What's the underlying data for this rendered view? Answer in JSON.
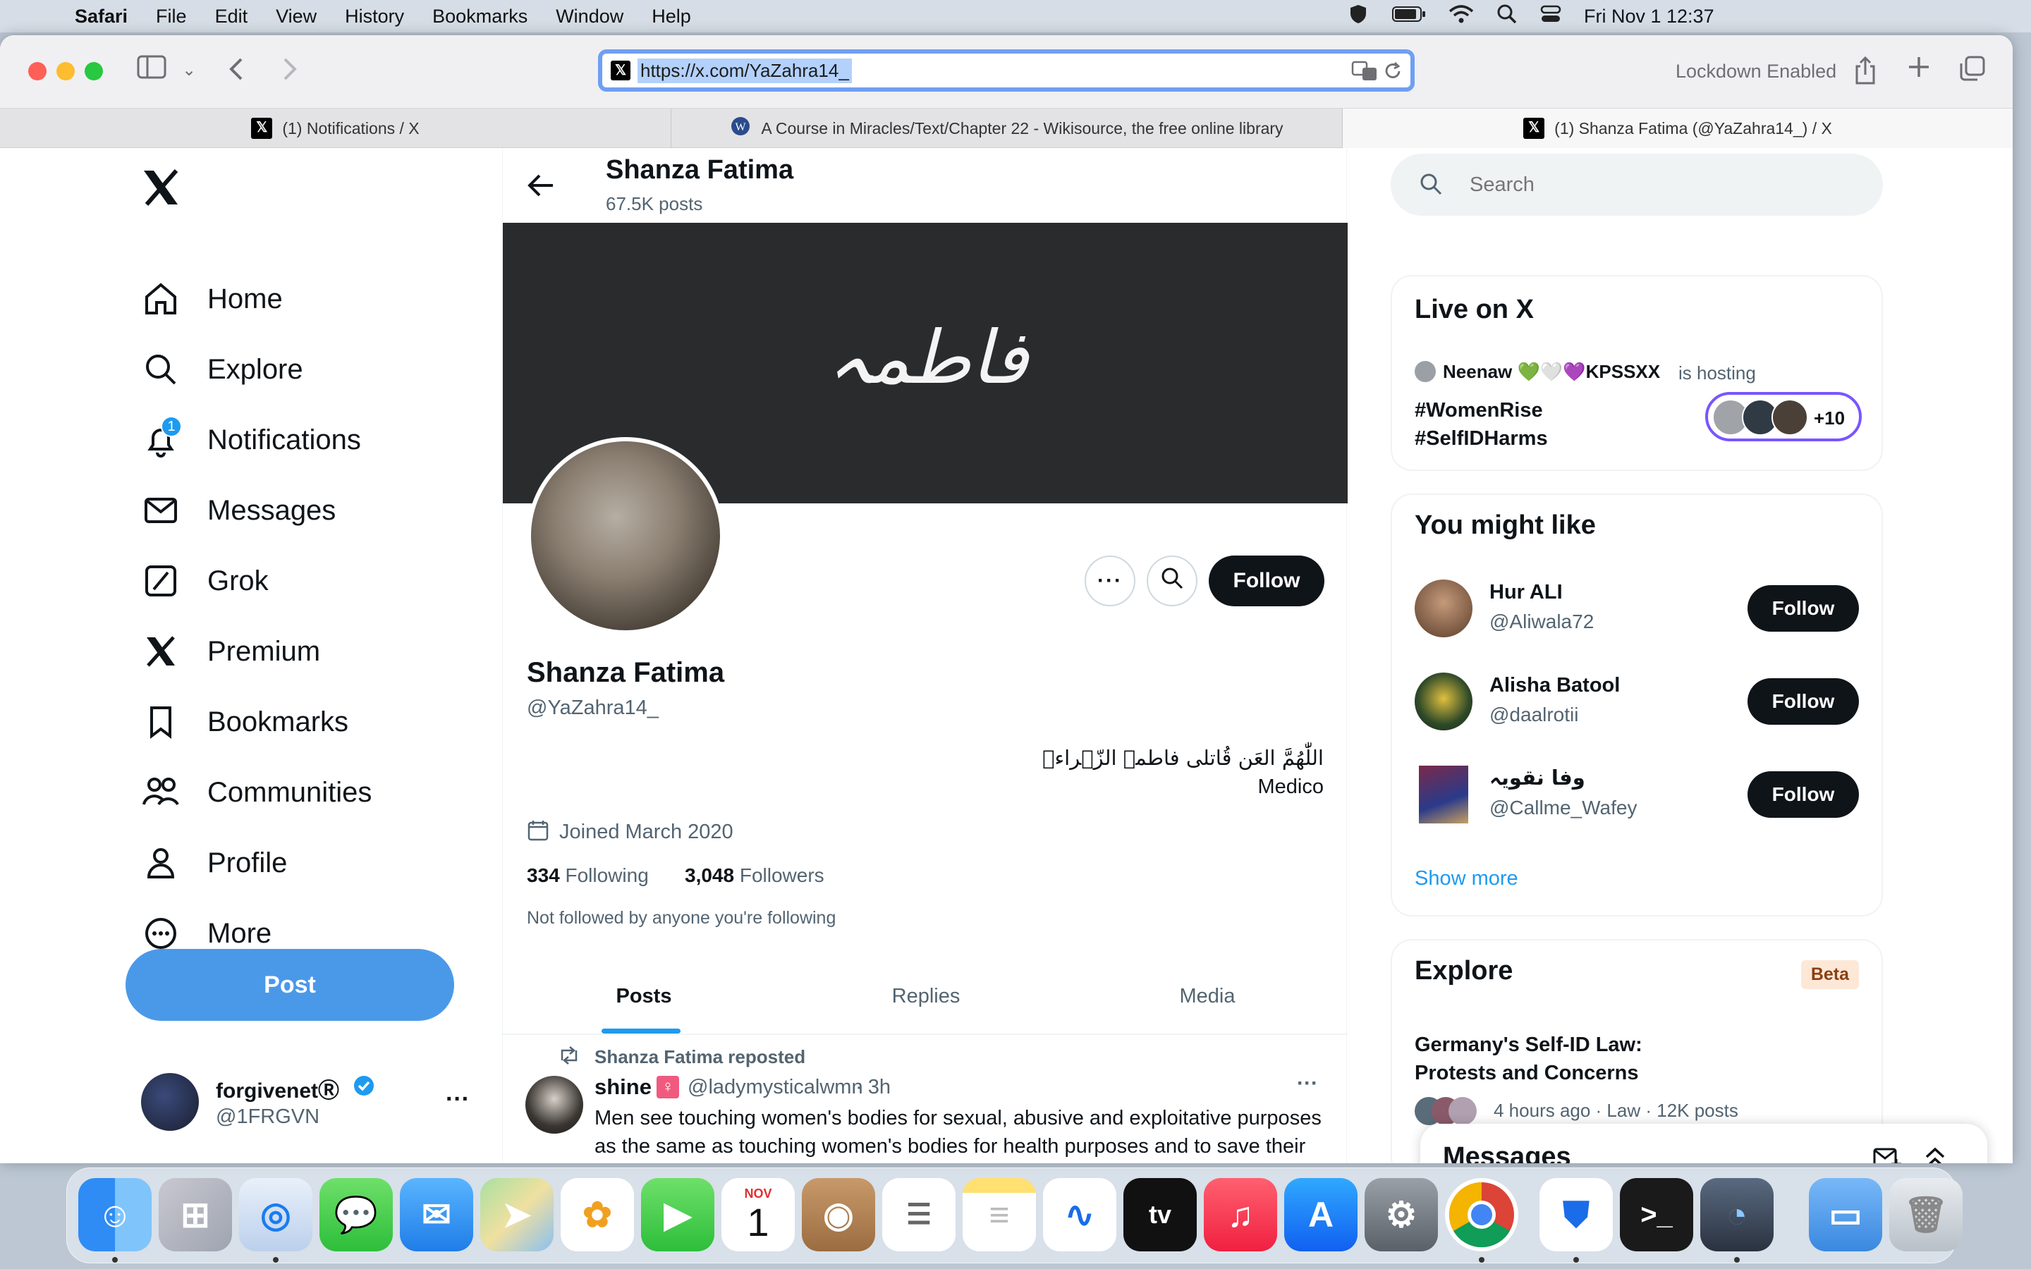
{
  "menubar": {
    "app": "Safari",
    "items": [
      "File",
      "Edit",
      "View",
      "History",
      "Bookmarks",
      "Window",
      "Help"
    ],
    "datetime": "Fri Nov 1  12:37"
  },
  "browser": {
    "url": "https://x.com/YaZahra14_",
    "lockdown": "Lockdown Enabled",
    "tabs": [
      {
        "title": "(1) Notifications / X"
      },
      {
        "title": "A Course in Miracles/Text/Chapter 22 - Wikisource, the free online library"
      },
      {
        "title": "(1) Shanza Fatima (@YaZahra14_) / X"
      }
    ]
  },
  "nav": {
    "items": [
      {
        "label": "Home",
        "icon": "home-icon"
      },
      {
        "label": "Explore",
        "icon": "search-icon"
      },
      {
        "label": "Notifications",
        "icon": "bell-icon",
        "badge": "1"
      },
      {
        "label": "Messages",
        "icon": "envelope-icon"
      },
      {
        "label": "Grok",
        "icon": "grok-icon"
      },
      {
        "label": "Premium",
        "icon": "x-logo-icon"
      },
      {
        "label": "Bookmarks",
        "icon": "bookmark-icon"
      },
      {
        "label": "Communities",
        "icon": "people-icon"
      },
      {
        "label": "Profile",
        "icon": "person-icon"
      },
      {
        "label": "More",
        "icon": "more-circle-icon"
      }
    ],
    "post_label": "Post",
    "account": {
      "name": "forgivenetⓇ",
      "handle": "@1FRGVN"
    }
  },
  "profile": {
    "header_name": "Shanza Fatima",
    "header_posts": "67.5K posts",
    "banner_text": "فاطمہ",
    "name": "Shanza Fatima",
    "handle": "@YaZahra14_",
    "bio_line1": "اللّٰهُمَّ العَن قُاتلی فاطمۃ الزّہراءؑ",
    "bio_line2": "Medico",
    "joined": "Joined March 2020",
    "following_count": "334",
    "following_label": "Following",
    "followers_count": "3,048",
    "followers_label": "Followers",
    "not_followed": "Not followed by anyone you're following",
    "follow_label": "Follow"
  },
  "tabs": [
    "Posts",
    "Replies",
    "Media"
  ],
  "post": {
    "repost_text": "Shanza Fatima reposted",
    "author": "shine",
    "handle": "@ladymysticalwmn",
    "time": "· 3h",
    "text": "Men see touching women's bodies for sexual, abusive and exploitative purposes as the same as touching women's bodies for health purposes and to save their lives when they're dying. Yeah logical gender"
  },
  "sidebar": {
    "search_placeholder": "Search",
    "live": {
      "title": "Live on X",
      "host": "Neenaw 💚🤍💜KPSSXX",
      "hosting": "is hosting",
      "topic1": "#WomenRise",
      "topic2": "#SelfIDHarms",
      "extra": "+10"
    },
    "might_like": {
      "title": "You might like",
      "users": [
        {
          "name": "Hur ALI",
          "handle": "@Aliwala72"
        },
        {
          "name": "Alisha Batool",
          "handle": "@daalrotii"
        },
        {
          "name": "وفا نقویہ",
          "handle": "@Callme_Wafey"
        }
      ],
      "show_more": "Show more"
    },
    "explore": {
      "title": "Explore",
      "badge": "Beta",
      "headline": "Germany's Self-ID Law: Protests and Concerns",
      "meta": "4 hours ago · Law · 12K posts"
    },
    "messages_title": "Messages"
  },
  "dock": {
    "calendar_month": "NOV",
    "calendar_day": "1"
  }
}
